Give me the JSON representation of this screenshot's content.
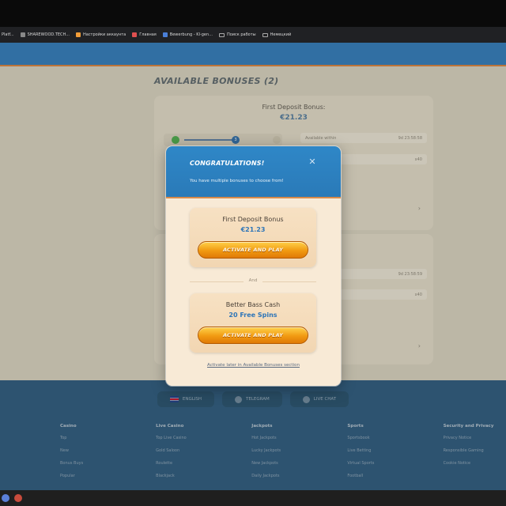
{
  "browser": {
    "bookmarks": [
      {
        "label": "Platf...",
        "icon": "page-icon"
      },
      {
        "label": "SHAREWOOD.TECH...",
        "icon": "page-icon"
      },
      {
        "label": "Настройки аккаунта",
        "icon": "orange-square-icon"
      },
      {
        "label": "Главная",
        "icon": "red-square-icon"
      },
      {
        "label": "Bewerbung - KI-gen...",
        "icon": "page-icon"
      },
      {
        "label": "Поиск работы",
        "icon": "folder-icon"
      },
      {
        "label": "Немецкий",
        "icon": "folder-icon"
      }
    ]
  },
  "page": {
    "title": "AVAILABLE BONUSES (2)",
    "card1": {
      "title": "First Deposit Bonus:",
      "amount": "€21.23",
      "step": "3",
      "available_label": "Available within",
      "available_time": "9d 23:58:58",
      "requirement": "x40"
    },
    "card2": {
      "available_time": "9d 23:58:59",
      "requirement": "x40"
    }
  },
  "modal": {
    "title": "CONGRATULATIONS!",
    "subtitle": "You have multiple bonuses to choose from!",
    "close_glyph": "✕",
    "offers": [
      {
        "name": "First Deposit Bonus",
        "value": "€21.23",
        "button": "ACTIVATE AND PLAY"
      },
      {
        "name": "Better Bass Cash",
        "value": "20 Free Spins",
        "button": "ACTIVATE AND PLAY"
      }
    ],
    "separator": "And",
    "later_link": "Activate later in Available Bonuses section"
  },
  "footer": {
    "buttons": [
      {
        "label": "ENGLISH",
        "icon": "uk-flag-icon"
      },
      {
        "label": "TELEGRAM",
        "icon": "telegram-icon"
      },
      {
        "label": "LIVE CHAT",
        "icon": "chat-icon"
      }
    ],
    "columns": [
      {
        "heading": "Casino",
        "items": [
          "Top",
          "New",
          "Bonus Buys",
          "Popular"
        ]
      },
      {
        "heading": "Live Casino",
        "items": [
          "Top Live Casino",
          "Gold Saloon",
          "Roulette",
          "Blackjack"
        ]
      },
      {
        "heading": "Jackpots",
        "items": [
          "Hot Jackpots",
          "Lucky Jackpots",
          "New Jackpots",
          "Daily Jackpots"
        ]
      },
      {
        "heading": "Sports",
        "items": [
          "Sportsbook",
          "Live Betting",
          "Virtual Sports",
          "Football"
        ]
      },
      {
        "heading": "Security and Privacy",
        "items": [
          "Privacy Notice",
          "Responsible Gaming",
          "Cookie Notice"
        ]
      }
    ]
  },
  "colors": {
    "accent_blue": "#2f87c7",
    "button_orange": "#f19a12",
    "value_blue": "#2e75b8"
  }
}
